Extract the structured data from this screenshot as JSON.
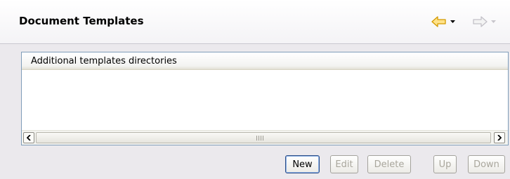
{
  "header": {
    "title": "Document Templates"
  },
  "nav": {
    "back_icon": "arrow-left-icon",
    "forward_icon": "arrow-right-icon",
    "back_color": "#f2a900",
    "forward_enabled": false
  },
  "list": {
    "column_header": "Additional templates directories",
    "rows": []
  },
  "buttons": {
    "new": "New",
    "edit": "Edit",
    "delete": "Delete",
    "up": "Up",
    "down": "Down"
  }
}
